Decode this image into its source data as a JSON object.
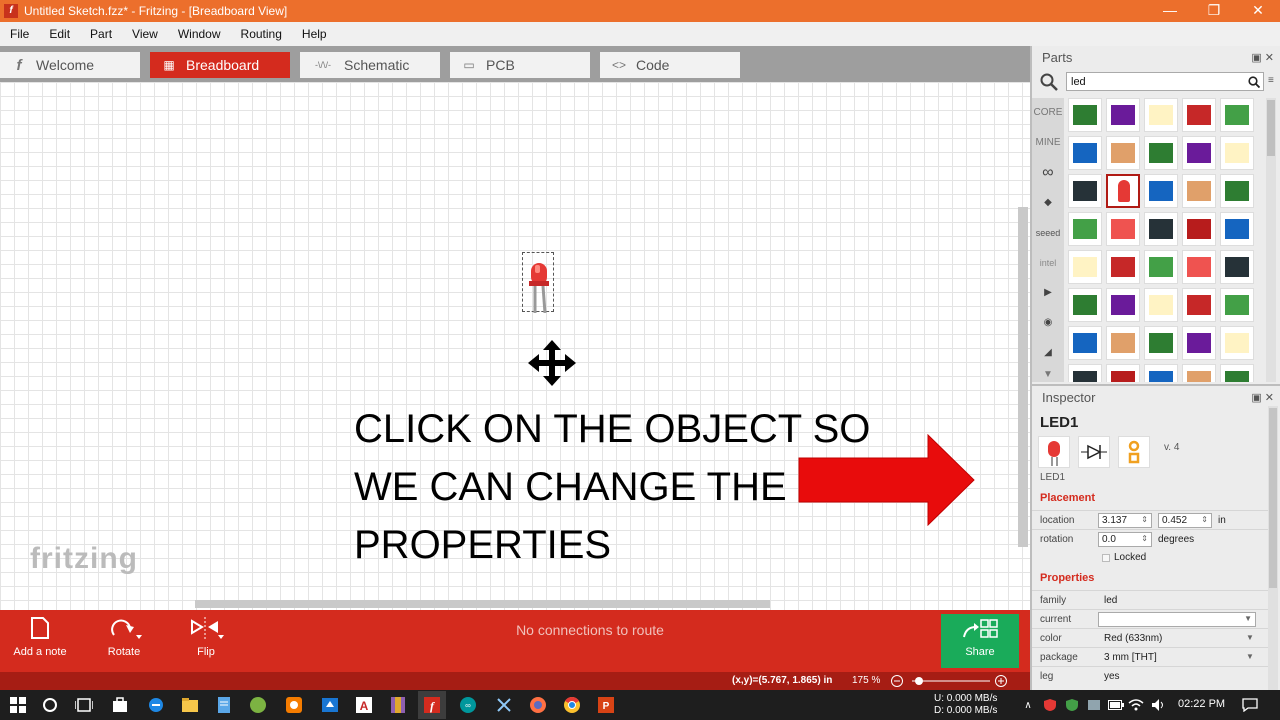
{
  "window": {
    "title": "Untitled Sketch.fzz* - Fritzing - [Breadboard View]",
    "app_icon": "f",
    "minimize": "—",
    "maximize": "❐",
    "close": "✕"
  },
  "menu": [
    "File",
    "Edit",
    "Part",
    "View",
    "Window",
    "Routing",
    "Help"
  ],
  "tabs": [
    {
      "label": "Welcome",
      "icon": "fritzing-f-icon"
    },
    {
      "label": "Breadboard",
      "icon": "breadboard-icon",
      "active": true
    },
    {
      "label": "Schematic",
      "icon": "resistor-icon"
    },
    {
      "label": "PCB",
      "icon": "pcb-icon"
    },
    {
      "label": "Code",
      "icon": "code-icon"
    }
  ],
  "tab_glyphs": [
    "f",
    "▦",
    "-\\/\\/-",
    "▭",
    "<>"
  ],
  "canvas": {
    "logo": "fritzing",
    "callout": "CLICK ON THE OBJECT SO WE CAN CHANGE THE PROPERTIES"
  },
  "toolbar": {
    "add_note": "Add a note",
    "rotate": "Rotate",
    "flip": "Flip",
    "routing_status": "No connections to route",
    "share": "Share"
  },
  "status": {
    "coords": "(x,y)=(5.767, 1.865) in",
    "zoom": "175 %"
  },
  "parts": {
    "title": "Parts",
    "search_value": "led",
    "bins": [
      "CORE",
      "MINE",
      "∞",
      "◆",
      "seeed",
      "intel",
      "▶",
      "◉",
      "◢",
      "▼"
    ]
  },
  "inspector": {
    "title": "Inspector",
    "part_name": "LED1",
    "part_label": "LED1",
    "version": "v. 4",
    "placement_title": "Placement",
    "location_label": "location",
    "location_x": "3.137",
    "location_y": "0.452",
    "location_unit": "in",
    "rotation_label": "rotation",
    "rotation_value": "0.0",
    "rotation_unit": "degrees",
    "locked_label": "Locked",
    "properties_title": "Properties",
    "family_label": "family",
    "family_value": "led",
    "current_label": "current",
    "current_value": "",
    "color_label": "color",
    "color_value": "Red (633nm)",
    "package_label": "package",
    "package_value": "3 mm [THT]",
    "leg_label": "leg",
    "leg_value": "yes"
  },
  "taskbar": {
    "net_up": "U:   0.000 MB/s",
    "net_down": "D:   0.000 MB/s",
    "clock": "02:22 PM"
  },
  "colors": {
    "accent": "#d42b1e",
    "titlebar": "#ec6f2c",
    "share": "#1aab5a"
  }
}
